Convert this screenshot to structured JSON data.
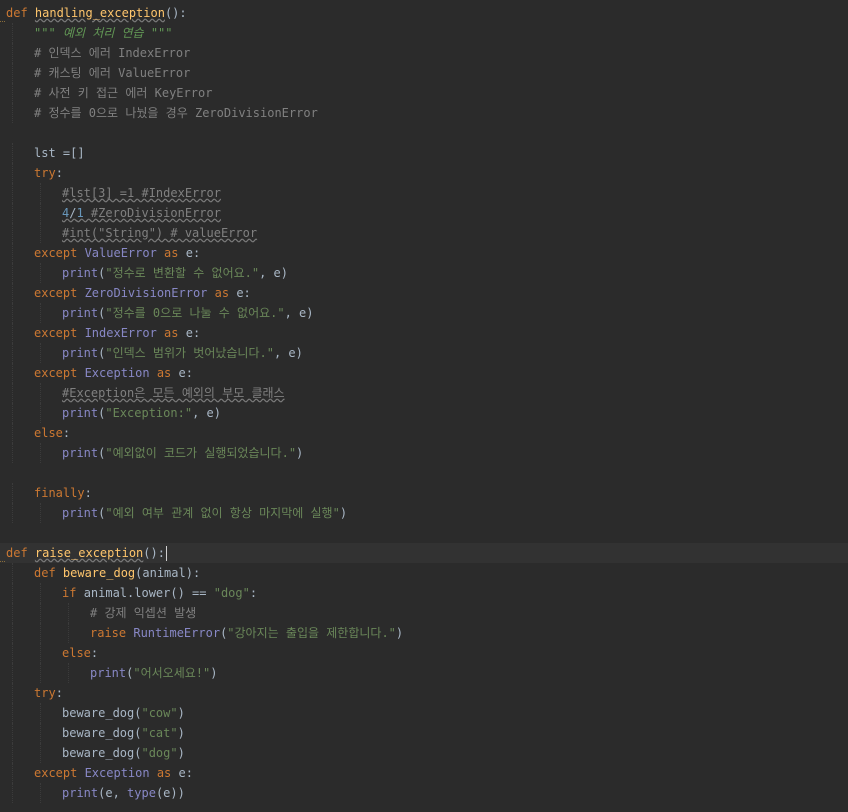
{
  "editor": {
    "language": "python",
    "theme_colors": {
      "background": "#2b2b2b",
      "current_line": "#323232",
      "keyword": "#cc7832",
      "function_name": "#ffc66d",
      "string": "#6a8759",
      "docstring": "#629755",
      "comment": "#808080",
      "number": "#6897bb",
      "builtin": "#8888c6",
      "plain": "#a9b7c6"
    },
    "lines": [
      {
        "i": 0,
        "mark": true,
        "t": [
          {
            "c": "k",
            "v": "def "
          },
          {
            "c": "fn u",
            "v": "handling_exception"
          },
          {
            "c": "p",
            "v": "():"
          }
        ]
      },
      {
        "i": 1,
        "t": [
          {
            "c": "ds",
            "v": "\"\"\" 예외 처리 연습 \"\"\""
          }
        ]
      },
      {
        "i": 1,
        "t": [
          {
            "c": "c",
            "v": "# 인덱스 에러 IndexError"
          }
        ]
      },
      {
        "i": 1,
        "t": [
          {
            "c": "c",
            "v": "# 캐스팅 에러 ValueError"
          }
        ]
      },
      {
        "i": 1,
        "t": [
          {
            "c": "c",
            "v": "# 사전 키 접근 에러 KeyError"
          }
        ]
      },
      {
        "i": 1,
        "t": [
          {
            "c": "c",
            "v": "# 정수를 0으로 나눴을 경우 ZeroDivisionError"
          }
        ]
      },
      {
        "i": 0,
        "t": []
      },
      {
        "i": 1,
        "t": [
          {
            "c": "p",
            "v": "lst =[]"
          }
        ]
      },
      {
        "i": 1,
        "t": [
          {
            "c": "k",
            "v": "try"
          },
          {
            "c": "p",
            "v": ":"
          }
        ]
      },
      {
        "i": 2,
        "t": [
          {
            "c": "c u",
            "v": "#lst[3] =1 #IndexError"
          }
        ]
      },
      {
        "i": 2,
        "t": [
          {
            "c": "n u",
            "v": "4"
          },
          {
            "c": "p u",
            "v": "/"
          },
          {
            "c": "n u",
            "v": "1"
          },
          {
            "c": "c u",
            "v": " #ZeroDivisionError"
          }
        ]
      },
      {
        "i": 2,
        "t": [
          {
            "c": "c u",
            "v": "#int(\"String\") # valueError"
          }
        ]
      },
      {
        "i": 1,
        "t": [
          {
            "c": "k",
            "v": "except "
          },
          {
            "c": "b",
            "v": "ValueError"
          },
          {
            "c": "k",
            "v": " as "
          },
          {
            "c": "p",
            "v": "e:"
          }
        ]
      },
      {
        "i": 2,
        "t": [
          {
            "c": "b",
            "v": "print"
          },
          {
            "c": "p",
            "v": "("
          },
          {
            "c": "s",
            "v": "\"정수로 변환할 수 없어요.\""
          },
          {
            "c": "p",
            "v": ", e)"
          }
        ]
      },
      {
        "i": 1,
        "t": [
          {
            "c": "k",
            "v": "except "
          },
          {
            "c": "b",
            "v": "ZeroDivisionError"
          },
          {
            "c": "k",
            "v": " as "
          },
          {
            "c": "p",
            "v": "e:"
          }
        ]
      },
      {
        "i": 2,
        "t": [
          {
            "c": "b",
            "v": "print"
          },
          {
            "c": "p",
            "v": "("
          },
          {
            "c": "s",
            "v": "\"정수를 0으로 나눌 수 없어요.\""
          },
          {
            "c": "p",
            "v": ", e)"
          }
        ]
      },
      {
        "i": 1,
        "t": [
          {
            "c": "k",
            "v": "except "
          },
          {
            "c": "b",
            "v": "IndexError"
          },
          {
            "c": "k",
            "v": " as "
          },
          {
            "c": "p",
            "v": "e:"
          }
        ]
      },
      {
        "i": 2,
        "t": [
          {
            "c": "b",
            "v": "print"
          },
          {
            "c": "p",
            "v": "("
          },
          {
            "c": "s",
            "v": "\"인덱스 범위가 벗어났습니다.\""
          },
          {
            "c": "p",
            "v": ", e)"
          }
        ]
      },
      {
        "i": 1,
        "t": [
          {
            "c": "k",
            "v": "except "
          },
          {
            "c": "b",
            "v": "Exception"
          },
          {
            "c": "k",
            "v": " as "
          },
          {
            "c": "p",
            "v": "e:"
          }
        ]
      },
      {
        "i": 2,
        "t": [
          {
            "c": "c u",
            "v": "#Exception은 모든 예외의 부모 클래스"
          }
        ]
      },
      {
        "i": 2,
        "t": [
          {
            "c": "b",
            "v": "print"
          },
          {
            "c": "p",
            "v": "("
          },
          {
            "c": "s",
            "v": "\"Exception:\""
          },
          {
            "c": "p",
            "v": ", e)"
          }
        ]
      },
      {
        "i": 1,
        "t": [
          {
            "c": "k",
            "v": "else"
          },
          {
            "c": "p",
            "v": ":"
          }
        ]
      },
      {
        "i": 2,
        "t": [
          {
            "c": "b",
            "v": "print"
          },
          {
            "c": "p",
            "v": "("
          },
          {
            "c": "s",
            "v": "\"예외없이 코드가 실행되었습니다.\""
          },
          {
            "c": "p",
            "v": ")"
          }
        ]
      },
      {
        "i": 0,
        "t": []
      },
      {
        "i": 1,
        "t": [
          {
            "c": "k",
            "v": "finally"
          },
          {
            "c": "p",
            "v": ":"
          }
        ]
      },
      {
        "i": 2,
        "t": [
          {
            "c": "b",
            "v": "print"
          },
          {
            "c": "p",
            "v": "("
          },
          {
            "c": "s",
            "v": "\"예외 여부 관계 없이 항상 마지막에 실행\""
          },
          {
            "c": "p",
            "v": ")"
          }
        ]
      },
      {
        "i": 0,
        "t": []
      },
      {
        "i": 0,
        "mark": true,
        "current": true,
        "caret": true,
        "t": [
          {
            "c": "k",
            "v": "def "
          },
          {
            "c": "fn u",
            "v": "raise_exception"
          },
          {
            "c": "p",
            "v": "():"
          }
        ]
      },
      {
        "i": 1,
        "t": [
          {
            "c": "k",
            "v": "def "
          },
          {
            "c": "fn",
            "v": "beware_dog"
          },
          {
            "c": "p",
            "v": "(animal):"
          }
        ]
      },
      {
        "i": 2,
        "t": [
          {
            "c": "k",
            "v": "if "
          },
          {
            "c": "p",
            "v": "animal.lower() == "
          },
          {
            "c": "s",
            "v": "\"dog\""
          },
          {
            "c": "p",
            "v": ":"
          }
        ]
      },
      {
        "i": 3,
        "t": [
          {
            "c": "c",
            "v": "# 강제 익셉션 발생"
          }
        ]
      },
      {
        "i": 3,
        "t": [
          {
            "c": "k",
            "v": "raise "
          },
          {
            "c": "b",
            "v": "RuntimeError"
          },
          {
            "c": "p",
            "v": "("
          },
          {
            "c": "s",
            "v": "\"강아지는 출입을 제한합니다.\""
          },
          {
            "c": "p",
            "v": ")"
          }
        ]
      },
      {
        "i": 2,
        "t": [
          {
            "c": "k",
            "v": "else"
          },
          {
            "c": "p",
            "v": ":"
          }
        ]
      },
      {
        "i": 3,
        "t": [
          {
            "c": "b",
            "v": "print"
          },
          {
            "c": "p",
            "v": "("
          },
          {
            "c": "s",
            "v": "\"어서오세요!\""
          },
          {
            "c": "p",
            "v": ")"
          }
        ]
      },
      {
        "i": 1,
        "t": [
          {
            "c": "k",
            "v": "try"
          },
          {
            "c": "p",
            "v": ":"
          }
        ]
      },
      {
        "i": 2,
        "t": [
          {
            "c": "p",
            "v": "beware_dog("
          },
          {
            "c": "s",
            "v": "\"cow\""
          },
          {
            "c": "p",
            "v": ")"
          }
        ]
      },
      {
        "i": 2,
        "t": [
          {
            "c": "p",
            "v": "beware_dog("
          },
          {
            "c": "s",
            "v": "\"cat\""
          },
          {
            "c": "p",
            "v": ")"
          }
        ]
      },
      {
        "i": 2,
        "t": [
          {
            "c": "p",
            "v": "beware_dog("
          },
          {
            "c": "s",
            "v": "\"dog\""
          },
          {
            "c": "p",
            "v": ")"
          }
        ]
      },
      {
        "i": 1,
        "t": [
          {
            "c": "k",
            "v": "except "
          },
          {
            "c": "b",
            "v": "Exception"
          },
          {
            "c": "k",
            "v": " as "
          },
          {
            "c": "p",
            "v": "e:"
          }
        ]
      },
      {
        "i": 2,
        "t": [
          {
            "c": "b",
            "v": "print"
          },
          {
            "c": "p",
            "v": "(e, "
          },
          {
            "c": "b",
            "v": "type"
          },
          {
            "c": "p",
            "v": "(e))"
          }
        ]
      }
    ]
  }
}
